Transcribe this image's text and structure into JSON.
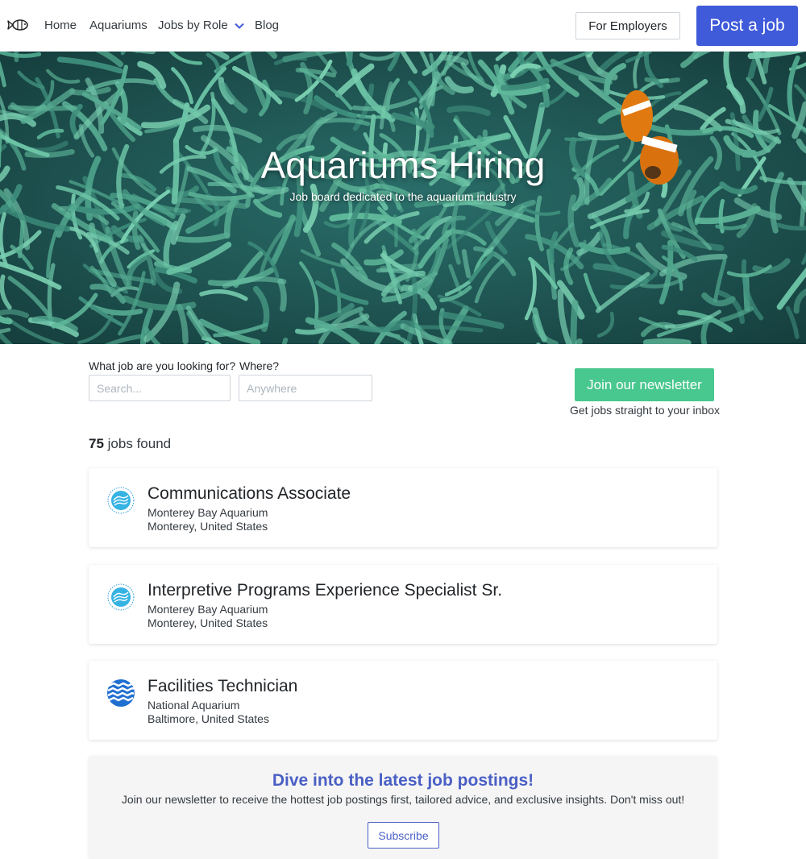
{
  "nav": {
    "home": "Home",
    "aquariums": "Aquariums",
    "jobs_by_role": "Jobs by Role",
    "blog": "Blog",
    "for_employers": "For Employers",
    "post_job": "Post a job"
  },
  "hero": {
    "title": "Aquariums Hiring",
    "subtitle": "Job board dedicated to the aquarium industry"
  },
  "search": {
    "what_label": "What job are you looking for?",
    "what_placeholder": "Search...",
    "where_label": "Where?",
    "where_placeholder": "Anywhere"
  },
  "newsletter_cta": {
    "button": "Join our newsletter",
    "subtext": "Get jobs straight to your inbox"
  },
  "results": {
    "count": "75",
    "label": "jobs found"
  },
  "jobs": [
    {
      "title": "Communications Associate",
      "company": "Monterey Bay Aquarium",
      "location": "Monterey, United States",
      "logo_icon": "monterey-bay-aquarium-logo"
    },
    {
      "title": "Interpretive Programs Experience Specialist Sr.",
      "company": "Monterey Bay Aquarium",
      "location": "Monterey, United States",
      "logo_icon": "monterey-bay-aquarium-logo"
    },
    {
      "title": "Facilities Technician",
      "company": "National Aquarium",
      "location": "Baltimore, United States",
      "logo_icon": "national-aquarium-logo"
    }
  ],
  "newsletter_box": {
    "title": "Dive into the latest job postings!",
    "text": "Join our newsletter to receive the hottest job postings first, tailored advice, and exclusive insights. Don't miss out!",
    "button": "Subscribe"
  },
  "colors": {
    "primary": "#3f5bd9",
    "success": "#48c78e",
    "newsletter_title": "#4a5fc4"
  }
}
